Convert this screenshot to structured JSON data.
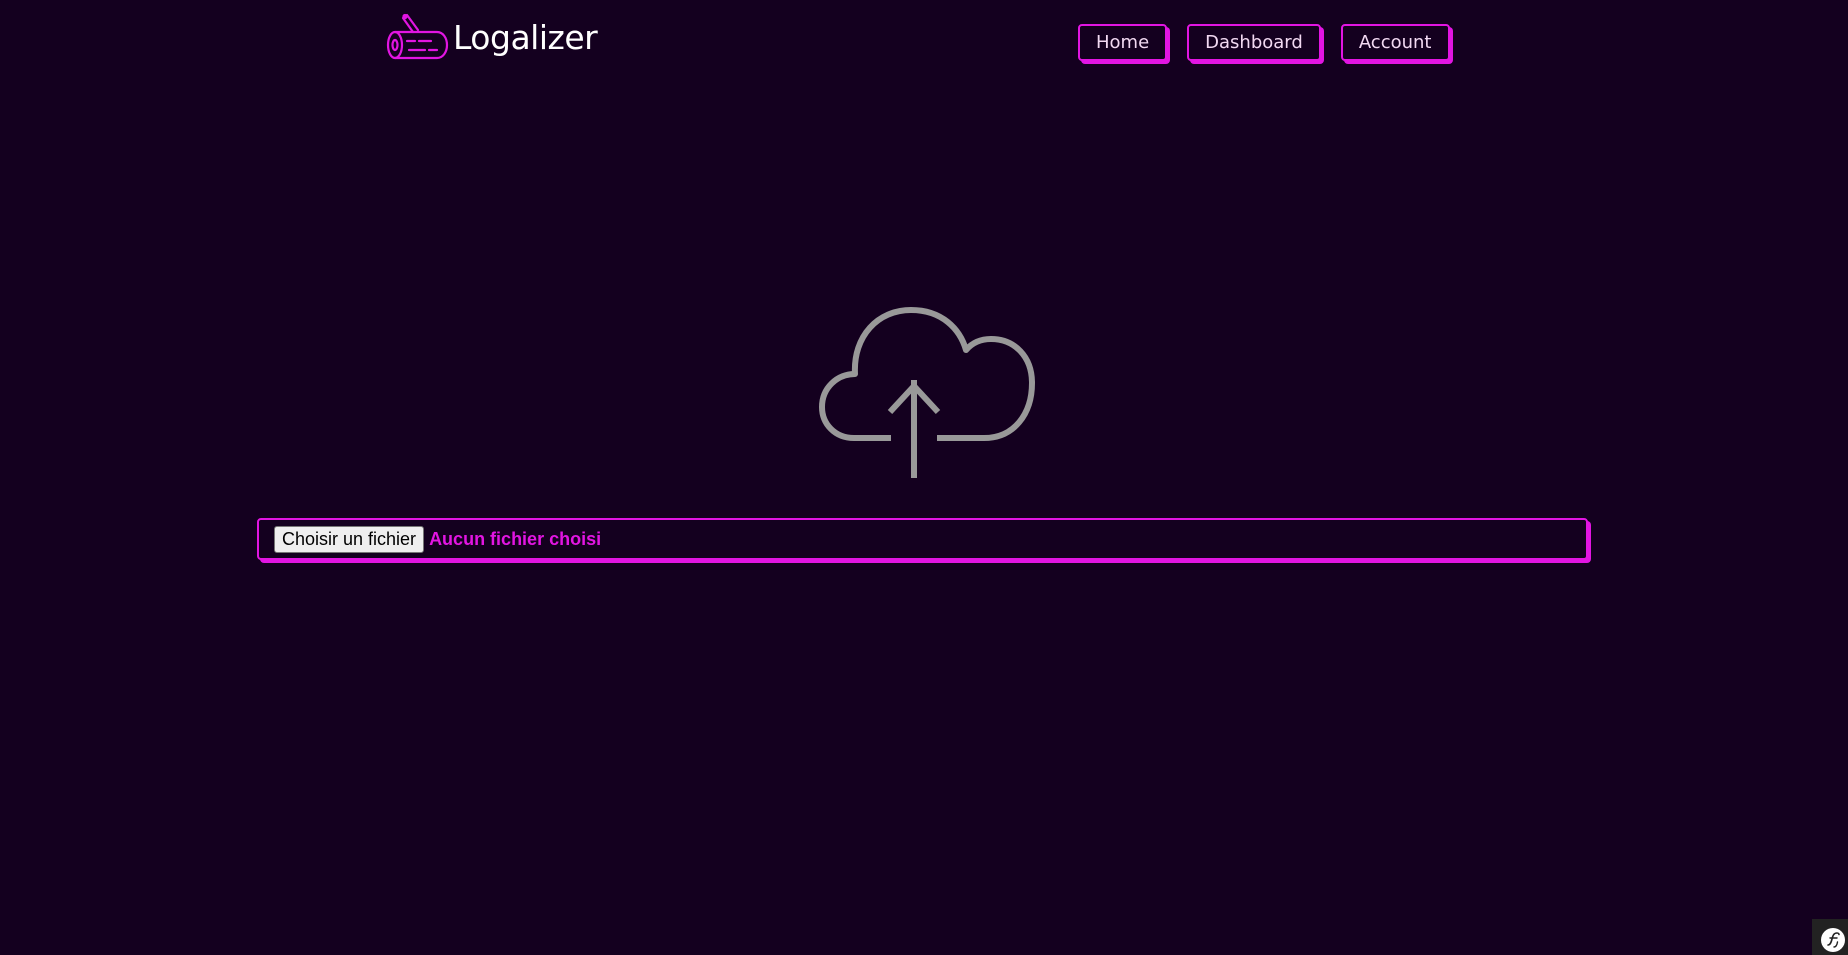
{
  "brand": {
    "name": "Logalizer",
    "logo_icon": "log-wood-icon",
    "accent_color": "#e215e2"
  },
  "nav": {
    "items": [
      {
        "label": "Home"
      },
      {
        "label": "Dashboard"
      },
      {
        "label": "Account"
      }
    ]
  },
  "upload": {
    "icon": "cloud-upload-icon",
    "button_label": "Choisir un fichier",
    "status_text": "Aucun fichier choisi"
  },
  "toolbar": {
    "icon": "symfony-icon"
  },
  "colors": {
    "background": "#14001f",
    "accent": "#e215e2",
    "icon_gray": "#999999"
  }
}
